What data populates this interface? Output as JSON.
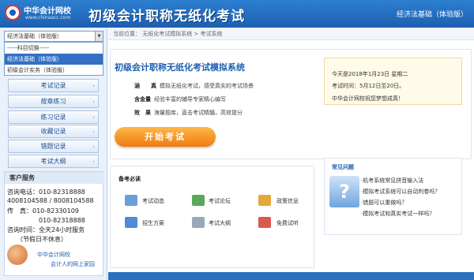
{
  "header": {
    "logo_name": "中华会计网校",
    "logo_url": "www.chinaacc.com",
    "title": "初级会计职称无纸化考试",
    "edition": "经济法基础（体验版）"
  },
  "sidebar": {
    "select_value": "经济法基础（体验版）",
    "dropdown_options": [
      "-----科目切换-----",
      "经济法基础（体验版）",
      "初级会计实务（体验版）"
    ],
    "menu": [
      "考试记录",
      "按章练习",
      "练习记录",
      "收藏记录",
      "错题记录",
      "考试大纲"
    ]
  },
  "service": {
    "title": "客户服务",
    "lines": [
      "咨询电话：010-82318888",
      "4008104588 / 8008104588",
      "传　真：010-82330109",
      "　　　　　010-82318888",
      "咨询时间：全天24小时服务",
      "　　（节假日不休息）"
    ],
    "footer_brand": "中华会计网校",
    "footer_slogan": "会计人的网上家园"
  },
  "breadcrumb": "当前位置：  无纸化考试模拟系统  >  考试系统",
  "welcome": {
    "title": "初级会计职称无纸化考试模拟系统",
    "features": [
      {
        "k": "涵　　真",
        "v": "模拟无纸化考试，感受真实的考试场景"
      },
      {
        "k": "含金量",
        "v": "经验丰富的辅导专家精心编写"
      },
      {
        "k": "效　果",
        "v": "海量题库，直击考试精髓，高效提分"
      }
    ],
    "start_label": "开始考试"
  },
  "date_box": {
    "today": "今天是2018年1月23日 星期二",
    "exam_time": "考试时间：5月12日至20日。",
    "wish": "中华会计网校祝您梦想成真！"
  },
  "tools": {
    "title": "备考必读",
    "items": [
      {
        "label": "考试动态",
        "color": "#6aa0d8"
      },
      {
        "label": "考试论坛",
        "color": "#5aa85a"
      },
      {
        "label": "政策信息",
        "color": "#e4a83a"
      },
      {
        "label": "招生方案",
        "color": "#4e8cd4"
      },
      {
        "label": "考试大纲",
        "color": "#9aa9b9"
      },
      {
        "label": "免费试听",
        "color": "#d75a4a"
      }
    ]
  },
  "faq": {
    "title": "常见问题",
    "items": [
      "·机考系统常见拼音输入法",
      "·模拟考试系统可以自动判卷吗？",
      "·错题可以重做吗？",
      "·模拟考试和真实考试一样吗？"
    ]
  }
}
